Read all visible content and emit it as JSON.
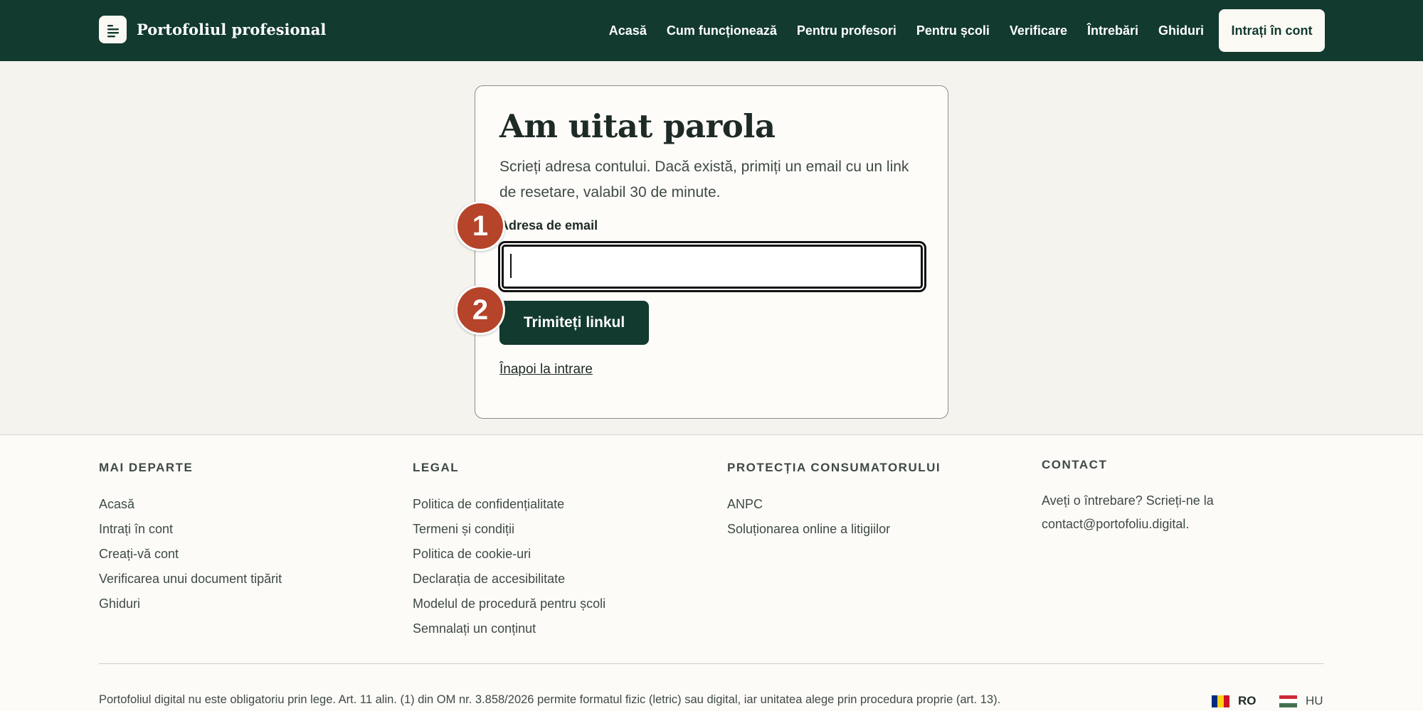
{
  "header": {
    "brand": "Portofoliul profesional",
    "nav": [
      "Acasă",
      "Cum funcționează",
      "Pentru profesori",
      "Pentru școli",
      "Verificare",
      "Întrebări",
      "Ghiduri"
    ],
    "login_label": "Intrați în cont"
  },
  "card": {
    "title": "Am uitat parola",
    "description": "Scrieți adresa contului. Dacă există, primiți un email cu un link de resetare, valabil 30 de minute.",
    "email_label": "Adresa de email",
    "email_value": "",
    "submit_label": "Trimiteți linkul",
    "back_link": "Înapoi la intrare"
  },
  "badges": [
    "1",
    "2"
  ],
  "footer": {
    "col1": {
      "heading": "MAI DEPARTE",
      "links": [
        "Acasă",
        "Intrați în cont",
        "Creați-vă cont",
        "Verificarea unui document tipărit",
        "Ghiduri"
      ]
    },
    "col2": {
      "heading": "LEGAL",
      "links": [
        "Politica de confidențialitate",
        "Termeni și condiții",
        "Politica de cookie-uri",
        "Declarația de accesibilitate",
        "Modelul de procedură pentru școli",
        "Semnalați un conținut"
      ]
    },
    "col3": {
      "heading": "PROTECȚIA CONSUMATORULUI",
      "links": [
        "ANPC",
        "Soluționarea online a litigiilor"
      ]
    },
    "col4": {
      "heading": "CONTACT",
      "text": "Aveți o întrebare? Scrieți-ne la contact@portofoliu.digital."
    },
    "disclaimer": "Portofoliul digital nu este obligatoriu prin lege. Art. 11 alin. (1) din OM nr. 3.858/2026 permite formatul fizic (letric) sau digital, iar unitatea alege prin procedura proprie (art. 13).",
    "languages": [
      "RO",
      "HU"
    ]
  },
  "colors": {
    "header_bg": "#123a2f",
    "badge_bg": "#b5442a",
    "page_bg": "#f5f3ee"
  }
}
